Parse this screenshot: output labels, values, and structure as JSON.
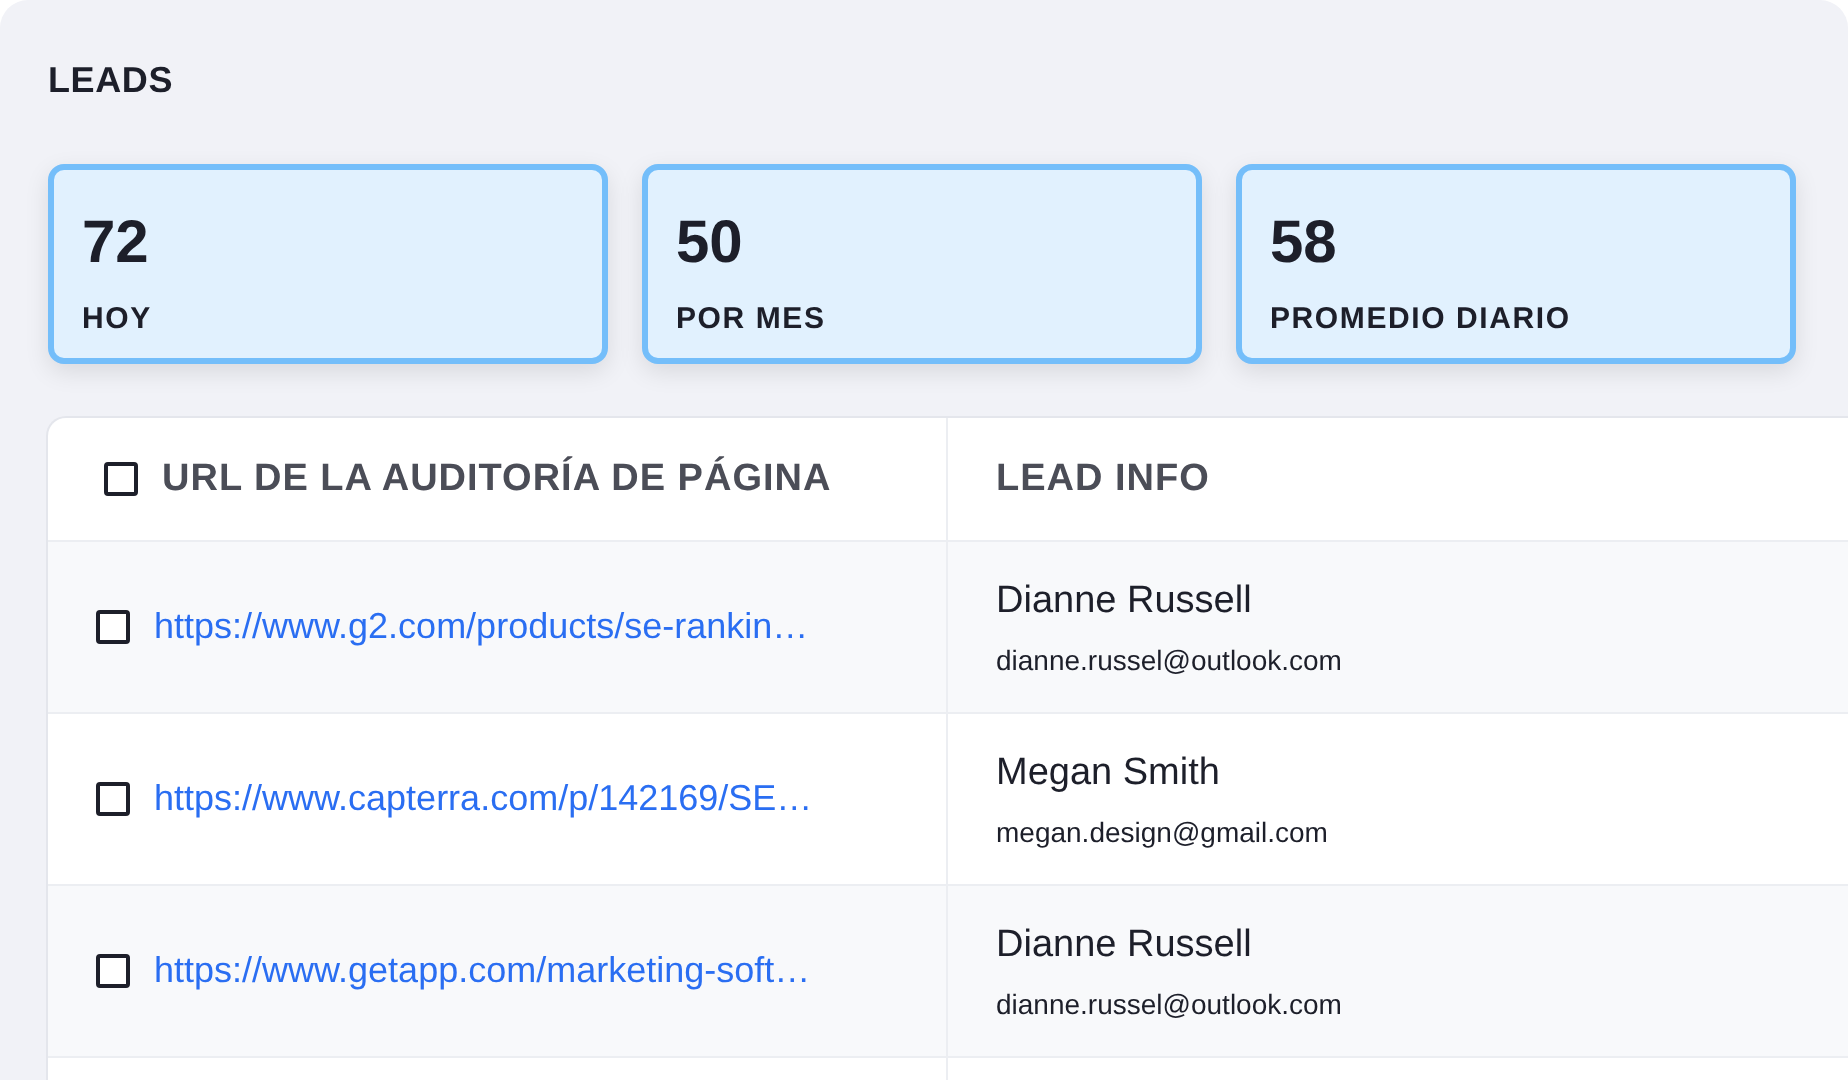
{
  "title": "LEADS",
  "stats": [
    {
      "value": "72",
      "label": "HOY"
    },
    {
      "value": "50",
      "label": "POR MES"
    },
    {
      "value": "58",
      "label": "PROMEDIO DIARIO"
    }
  ],
  "table": {
    "header_checked": false,
    "columns": [
      "URL DE LA AUDITORÍA DE PÁGINA",
      "LEAD INFO"
    ],
    "rows": [
      {
        "checked": false,
        "url": "https://www.g2.com/products/se-rankin…",
        "name": "Dianne Russell",
        "email": "dianne.russel@outlook.com"
      },
      {
        "checked": false,
        "url": "https://www.capterra.com/p/142169/SE…",
        "name": "Megan Smith",
        "email": "megan.design@gmail.com"
      },
      {
        "checked": false,
        "url": "https://www.getapp.com/marketing-soft…",
        "name": "Dianne Russell",
        "email": "dianne.russel@outlook.com"
      }
    ]
  }
}
